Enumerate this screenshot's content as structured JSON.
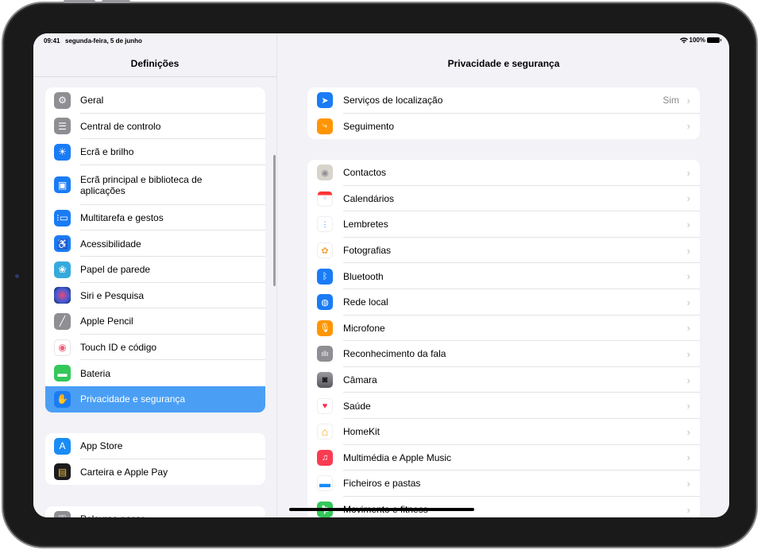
{
  "status_bar": {
    "time": "09:41",
    "date": "segunda-feira, 5 de junho",
    "battery": "100%"
  },
  "sidebar": {
    "title": "Definições",
    "groups": [
      {
        "items": [
          {
            "label": "Geral",
            "icon": "gear-icon",
            "color": "#8e8e93"
          },
          {
            "label": "Central de controlo",
            "icon": "toggles-icon",
            "color": "#8e8e93"
          },
          {
            "label": "Ecrã e brilho",
            "icon": "sun-icon",
            "color": "#1a7cf5"
          },
          {
            "label": "Ecrã principal e biblioteca de aplicações",
            "icon": "home-screen-icon",
            "color": "#1a7cf5"
          },
          {
            "label": "Multitarefa e gestos",
            "icon": "multitasking-icon",
            "color": "#1a7cf5"
          },
          {
            "label": "Acessibilidade",
            "icon": "accessibility-icon",
            "color": "#1a7cf5"
          },
          {
            "label": "Papel de parede",
            "icon": "wallpaper-icon",
            "color": "#35aadc"
          },
          {
            "label": "Siri e Pesquisa",
            "icon": "siri-icon",
            "color": "#2a2a3a"
          },
          {
            "label": "Apple Pencil",
            "icon": "pencil-icon",
            "color": "#8e8e93"
          },
          {
            "label": "Touch ID e código",
            "icon": "fingerprint-icon",
            "color": "#ffffff"
          },
          {
            "label": "Bateria",
            "icon": "battery-icon",
            "color": "#34c759"
          },
          {
            "label": "Privacidade e segurança",
            "icon": "hand-icon",
            "color": "#1a7cf5",
            "selected": true
          }
        ]
      },
      {
        "items": [
          {
            "label": "App Store",
            "icon": "app-store-icon",
            "color": "#1a8cf5"
          },
          {
            "label": "Carteira e Apple Pay",
            "icon": "wallet-icon",
            "color": "#1c1c1e"
          }
        ]
      },
      {
        "items": [
          {
            "label": "Palavras-passe",
            "icon": "key-icon",
            "color": "#8e8e93"
          }
        ]
      }
    ]
  },
  "detail": {
    "title": "Privacidade e segurança",
    "groups": [
      {
        "items": [
          {
            "label": "Serviços de localização",
            "value": "Sim",
            "icon": "location-arrow-icon",
            "color": "#1a7cf5"
          },
          {
            "label": "Seguimento",
            "value": "",
            "icon": "tracking-icon",
            "color": "#ff9500"
          }
        ]
      },
      {
        "items": [
          {
            "label": "Contactos",
            "icon": "contacts-icon",
            "color": "#d8d4cc"
          },
          {
            "label": "Calendários",
            "icon": "calendar-icon",
            "color": "#ffffff"
          },
          {
            "label": "Lembretes",
            "icon": "reminders-icon",
            "color": "#ffffff"
          },
          {
            "label": "Fotografias",
            "icon": "photos-icon",
            "color": "#ffffff"
          },
          {
            "label": "Bluetooth",
            "icon": "bluetooth-icon",
            "color": "#1a7cf5"
          },
          {
            "label": "Rede local",
            "icon": "globe-icon",
            "color": "#1a7cf5"
          },
          {
            "label": "Microfone",
            "icon": "microphone-icon",
            "color": "#ff9500"
          },
          {
            "label": "Reconhecimento da fala",
            "icon": "waveform-icon",
            "color": "#8e8e93"
          },
          {
            "label": "Câmara",
            "icon": "camera-icon",
            "color": "#6e6e73"
          },
          {
            "label": "Saúde",
            "icon": "heart-icon",
            "color": "#ffffff"
          },
          {
            "label": "HomeKit",
            "icon": "house-icon",
            "color": "#ffffff"
          },
          {
            "label": "Multimédia e Apple Music",
            "icon": "music-icon",
            "color": "#fa3c52"
          },
          {
            "label": "Ficheiros e pastas",
            "icon": "folder-icon",
            "color": "#ffffff"
          },
          {
            "label": "Movimento e fitness",
            "icon": "fitness-icon",
            "color": "#34c759"
          }
        ]
      }
    ]
  }
}
